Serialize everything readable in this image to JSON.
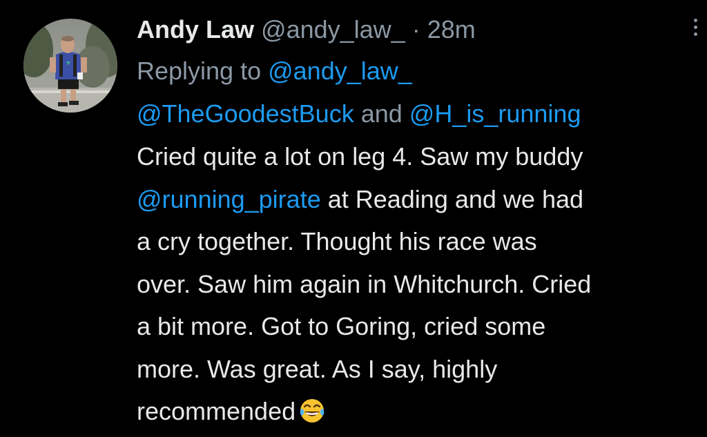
{
  "tweet": {
    "author": {
      "display_name": "Andy Law",
      "handle": "@andy_law_"
    },
    "separator": "·",
    "timestamp": "28m",
    "replying_to": {
      "prefix": "Replying to ",
      "mentions": [
        "@andy_law_",
        "@TheGoodestBuck",
        "@H_is_running"
      ],
      "joiner": " and "
    },
    "body": {
      "part1": "Cried quite a lot on leg 4. Saw my buddy ",
      "mention": "@running_pirate",
      "part2": " at Reading and we had a cry together. Thought his race was over. Saw him again in Whitchurch. Cried a bit more. Got to Goring, cried some more. Was great. As I say, highly recommended",
      "emoji": "face-with-tears-of-joy"
    },
    "more_menu_icon": "more-vertical-icon"
  },
  "colors": {
    "background": "#000000",
    "primary_text": "#e7e9ea",
    "secondary_text": "#8b98a5",
    "link": "#1d9bf0"
  }
}
